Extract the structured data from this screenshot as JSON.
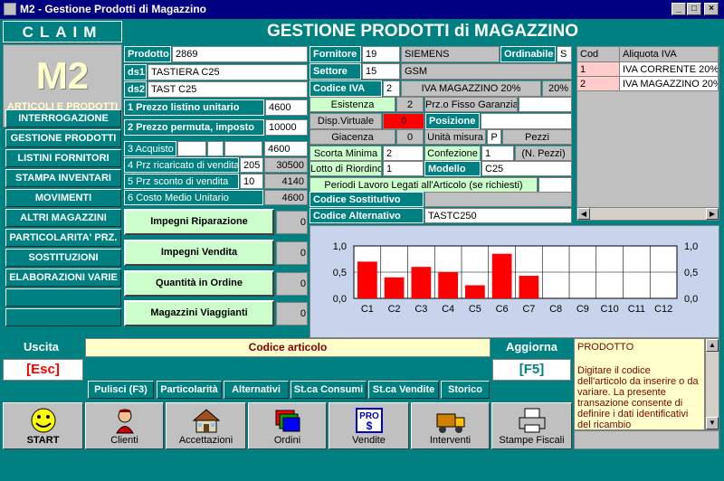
{
  "window": {
    "title": "M2 - Gestione Prodotti di Magazzino"
  },
  "brand": {
    "company": "CLAIM",
    "logo": "M2",
    "subtitle": "ARTICOLI E PRODOTTI"
  },
  "header": {
    "title": "GESTIONE PRODOTTI di MAGAZZINO"
  },
  "menu": [
    "INTERROGAZIONE",
    "GESTIONE PRODOTTI",
    "LISTINI FORNITORI",
    "STAMPA INVENTARI",
    "MOVIMENTI",
    "ALTRI MAGAZZINI",
    "PARTICOLARITA' PRZ.",
    "SOSTITUZIONI",
    "ELABORAZIONI VARIE"
  ],
  "product": {
    "prodotto_label": "Prodotto",
    "prodotto": "2869",
    "ds1_label": "ds1",
    "ds1": "TASTIERA C25",
    "ds2_label": "ds2",
    "ds2": "TAST C25"
  },
  "prices": {
    "p1_label": "1 Prezzo listino unitario",
    "p1": "4600",
    "p2_label": "2 Prezzo permuta, imposto",
    "p2": "10000",
    "p3_label": "3 Acquisto",
    "p3": "4600",
    "p4_label": "4 Prz ricaricato di vendita",
    "p4_pct": "205",
    "p4": "30500",
    "p5_label": "5 Prz sconto di vendita",
    "p5_pct": "10",
    "p5": "4140",
    "p6_label": "6 Costo Medio Unitario",
    "p6": "4600"
  },
  "supplier": {
    "fornitore_label": "Fornitore",
    "fornitore_code": "19",
    "fornitore_name": "SIEMENS",
    "ordinabile_label": "Ordinabile",
    "ordinabile": "S",
    "settore_label": "Settore",
    "settore_code": "15",
    "settore_name": "GSM",
    "iva_label": "Codice IVA",
    "iva_code": "2",
    "iva_desc": "IVA MAGAZZINO 20%",
    "iva_pct": "20%"
  },
  "stock": {
    "esistenza_label": "Esistenza",
    "esistenza": "2",
    "prz_fisso_label": "Prz.o Fisso Garanzia",
    "disp_label": "Disp.Virtuale",
    "disp": "0",
    "posizione_label": "Posizione",
    "giacenza_label": "Giacenza",
    "giacenza": "0",
    "unita_label": "Unità misura",
    "unita_code": "P",
    "unita": "Pezzi",
    "scorta_label": "Scorta Minima",
    "scorta": "2",
    "confezione_label": "Confezione",
    "confezione": "1",
    "npezzi": "(N. Pezzi)",
    "lotto_label": "Lotto di Riordino",
    "lotto": "1",
    "modello_label": "Modello",
    "modello": "C25",
    "periodi_label": "Periodi Lavoro Legati all'Articolo (se richiesti)",
    "sost_label": "Codice Sostitutivo",
    "sost": "",
    "alt_label": "Codice Alternativo",
    "alt": "TASTC250"
  },
  "iva_table": {
    "headers": [
      "Cod",
      "Aliquota IVA"
    ],
    "rows": [
      [
        "1",
        "IVA CORRENTE 20%"
      ],
      [
        "2",
        "IVA MAGAZZINO 20%"
      ]
    ]
  },
  "actions": {
    "impegni_rip": "Impegni Riparazione",
    "impegni_rip_val": "0",
    "impegni_ven": "Impegni Vendita",
    "impegni_ven_val": "0",
    "quant_ord": "Quantità in Ordine",
    "quant_ord_val": "0",
    "mag_viag": "Magazzini Viaggianti",
    "mag_viag_val": "0"
  },
  "chart_data": {
    "type": "bar",
    "categories": [
      "C1",
      "C2",
      "C3",
      "C4",
      "C5",
      "C6",
      "C7",
      "C8",
      "C9",
      "C10",
      "C11",
      "C12"
    ],
    "values": [
      0.7,
      0.4,
      0.6,
      0.5,
      0.25,
      0.85,
      0.43,
      0,
      0,
      0,
      0,
      0
    ],
    "ylim": [
      0,
      1
    ],
    "yticks": [
      "1,0",
      "0,5",
      "0,0"
    ],
    "bar_color": "#ff0000",
    "grid": true
  },
  "bottom": {
    "uscita_label": "Uscita",
    "uscita_key": "[Esc]",
    "codice_label": "Codice articolo",
    "aggiorna_label": "Aggiorna",
    "aggiorna_key": "[F5]",
    "buttons": [
      "Pulisci (F3)",
      "Particolarità",
      "Alternativi",
      "St.ca Consumi",
      "St.ca Vendite",
      "Storico"
    ]
  },
  "help": {
    "title": "PRODOTTO",
    "text": "Digitare il codice dell'articolo da inserire o da variare. La presente transazione consente di definire i dati identificativi del ricambio"
  },
  "toolbar": [
    "START",
    "Clienti",
    "Accettazioni",
    "Ordini",
    "Vendite",
    "Interventi",
    "Stampe Fiscali"
  ],
  "colors": {
    "teal": "#008080",
    "green_btn": "#ccffcc",
    "titlebar": "#000080",
    "bar": "#ff0000"
  }
}
